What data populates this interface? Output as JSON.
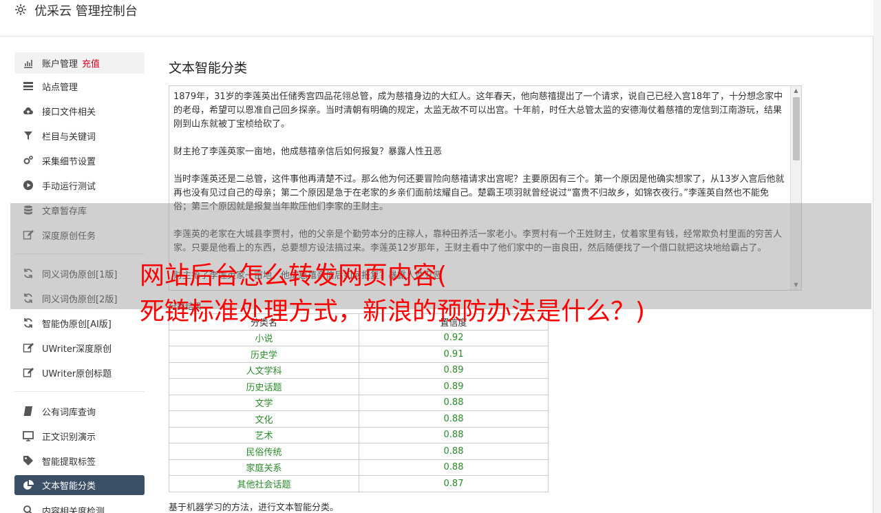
{
  "topbar": {
    "title": "优采云 管理控制台",
    "icon": "gear-icon"
  },
  "sidebar": {
    "items": [
      {
        "label": "账户管理",
        "badge": "充值",
        "icon": "bar-chart-icon"
      },
      {
        "label": "站点管理",
        "icon": "server-icon"
      },
      {
        "label": "接口文件相关",
        "icon": "cloud-upload-icon"
      },
      {
        "label": "栏目与关键词",
        "icon": "filter-icon"
      },
      {
        "label": "采集细节设置",
        "icon": "gears-icon"
      },
      {
        "label": "手动运行测试",
        "icon": "play-circle-icon"
      },
      {
        "label": "文章暂存库",
        "icon": "database-icon"
      },
      {
        "label": "深度原创任务",
        "icon": "edit-icon"
      },
      {
        "label": "同义词伪原创[1版]",
        "icon": "refresh-icon"
      },
      {
        "label": "同义词伪原创[2版]",
        "icon": "refresh-icon"
      },
      {
        "label": "智能伪原创[AI版]",
        "icon": "refresh-icon"
      },
      {
        "label": "UWriter深度原创",
        "icon": "edit-icon"
      },
      {
        "label": "UWriter原创标题",
        "icon": "edit-icon"
      },
      {
        "label": "公有词库查询",
        "icon": "book-icon"
      },
      {
        "label": "正文识别演示",
        "icon": "monitor-icon"
      },
      {
        "label": "智能提取标签",
        "icon": "tag-icon"
      },
      {
        "label": "文本智能分类",
        "icon": "pie-chart-icon"
      },
      {
        "label": "内容相关度检测",
        "icon": "search-icon"
      }
    ]
  },
  "main": {
    "title": "文本智能分类",
    "paragraphs": [
      "1879年，31岁的李莲英出任储秀宫四品花翎总管，成为慈禧身边的大红人。这年春天，他向慈禧提出了一个请求，说自己已经入宫18年了，十分想念家中的老母，希望可以恩准自己回乡探亲。当时清朝有明确的规定，太监无故不可以出宫。十年前，时任大总管太监的安德海仗着慈禧的宠信到江南游玩，结果刚到山东就被丁宝桢给砍了。",
      "财主抢了李莲英家一亩地，他成慈禧亲信后如何报复？暴露人性丑恶",
      "当时李莲英还是二总管，这件事他再清楚不过。那么他为何还要冒险向慈禧请求出宫呢？主要原因有三个。第一个原因是他确实想家了，从13岁入宫后他就再也没有见过自己的母亲；第二个原因是急于在老家的乡亲们面前炫耀自己。楚霸王项羽就曾经说过“富贵不归故乡，如锦衣夜行。”李莲英自然也不能免俗；第三个原因就是报复当年欺压他们李家的王财主。",
      "李莲英的老家在大城县李贾村，他的父亲是个勤劳本分的庄稼人，靠种田养活一家老小。李贾村有一个王姓财主，仗着家里有钱，经常欺负村里面的穷苦人家。只要是他看上的东西，总要想方设法搞过来。李莲英12岁那年，王财主看中了他们家中的一亩良田，然后随便找了一个借口就把这块地给霸占了。",
      "财主抢了李莲英家一亩地，他成慈禧亲信后如何报复？暴露人性丑恶"
    ],
    "result_label": "分类结果",
    "table": {
      "headers": [
        "分类名",
        "置信度"
      ],
      "rows": [
        {
          "category": "小说",
          "score": "0.92"
        },
        {
          "category": "历史学",
          "score": "0.91"
        },
        {
          "category": "人文学科",
          "score": "0.89"
        },
        {
          "category": "历史话题",
          "score": "0.89"
        },
        {
          "category": "文学",
          "score": "0.88"
        },
        {
          "category": "文化",
          "score": "0.88"
        },
        {
          "category": "艺术",
          "score": "0.88"
        },
        {
          "category": "民俗传统",
          "score": "0.88"
        },
        {
          "category": "家庭关系",
          "score": "0.88"
        },
        {
          "category": "其他社会话题",
          "score": "0.87"
        }
      ]
    },
    "footer_note": "基于机器学习的方法，进行文本智能分类。"
  },
  "overlay": {
    "line1": "网站后台怎么转发网页内容(",
    "line2": "死链标准处理方式，新浪的预防办法是什么？)"
  },
  "colors": {
    "accent_red": "#d9001b",
    "active_nav": "#3b4f66",
    "score_green": "#2a8a2a",
    "headline_red": "#ff0000"
  }
}
